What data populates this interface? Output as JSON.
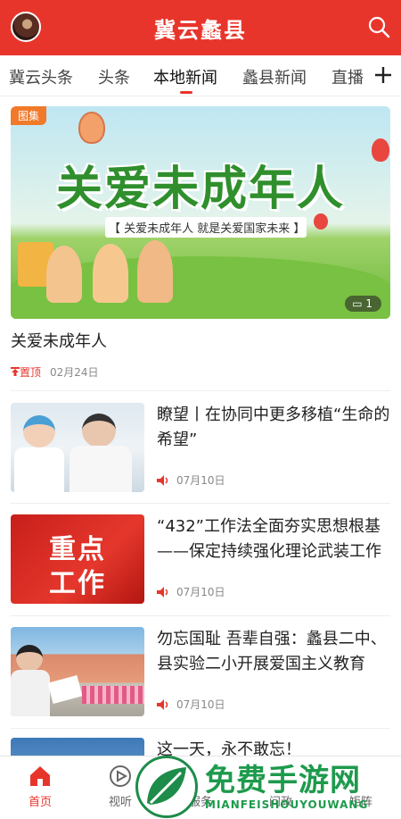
{
  "header": {
    "title": "冀云蠡县"
  },
  "tabs": [
    "冀云头条",
    "头条",
    "本地新闻",
    "蠡县新闻",
    "直播"
  ],
  "hero": {
    "tag": "图集",
    "banner_text": "关爱未成年人",
    "banner_sub": "【 关爱未成年人  就是关爱国家未来 】",
    "image_count": "1",
    "title": "关爱未成年人",
    "pinned_label": "置顶",
    "date": "02月24日"
  },
  "news": [
    {
      "title": "瞭望丨在协同中更多移植“生命的希望”",
      "date": "07月10日"
    },
    {
      "title": "“432”工作法全面夯实思想根基——保定持续强化理论武装工作",
      "date": "07月10日",
      "thumb_text": [
        "重点",
        "工作"
      ]
    },
    {
      "title": "勿忘国耻 吾辈自强：蠡县二中、县实验二小开展爱国主义教育",
      "date": "07月10日"
    },
    {
      "title": "这一天，永不敢忘！",
      "date": ""
    }
  ],
  "tabbar": [
    "首页",
    "视听",
    "服务",
    "问政",
    "矩阵"
  ],
  "watermark": {
    "main": "免费手游网",
    "en": "MIANFEISHOUYOUWANG"
  },
  "colors": {
    "brand": "#e8352c",
    "watermark": "#1d9a4c"
  }
}
